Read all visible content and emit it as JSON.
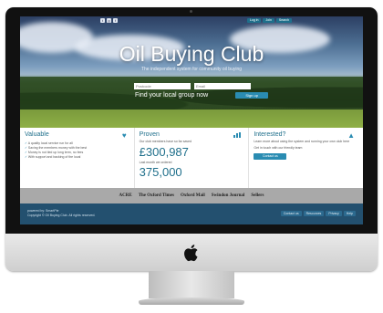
{
  "site": {
    "title": "Oil Buying Club",
    "subtitle": "The independent system for community oil buying",
    "social_icons": [
      "t",
      "g",
      "f"
    ],
    "top_links": [
      "Log in",
      "Join",
      "Search"
    ]
  },
  "hero": {
    "postcode_placeholder": "Postcode",
    "email_placeholder": "Email",
    "find_text": "Find your local group now",
    "signup_label": "Sign up"
  },
  "columns": {
    "valuable": {
      "heading": "Valuable",
      "items": [
        "A quality local service run for all",
        "Saving the members money with the best",
        "Money is not tied up long term, no fees",
        "With support and backing of the local"
      ]
    },
    "proven": {
      "heading": "Proven",
      "saved_label": "Our club members have so far saved",
      "saved_value": "£300,987",
      "litres_label": "Last month we ordered",
      "litres_value": "375,000"
    },
    "interested": {
      "heading": "Interested?",
      "text": "Learn more about using the system and running your own club here",
      "text2": "Get in touch with our friendly team",
      "contact_label": "Contact us"
    }
  },
  "press": [
    "ACRE",
    "The Oxford Times",
    "Oxford Mail",
    "Swindon Journal",
    "Sellers"
  ],
  "footer": {
    "powered": "powered by: SmartPie",
    "copyright": "Copyright © Oil Buying Club. All rights reserved.",
    "links": [
      "Contact us",
      "Resources",
      "Privacy",
      "Help"
    ]
  }
}
